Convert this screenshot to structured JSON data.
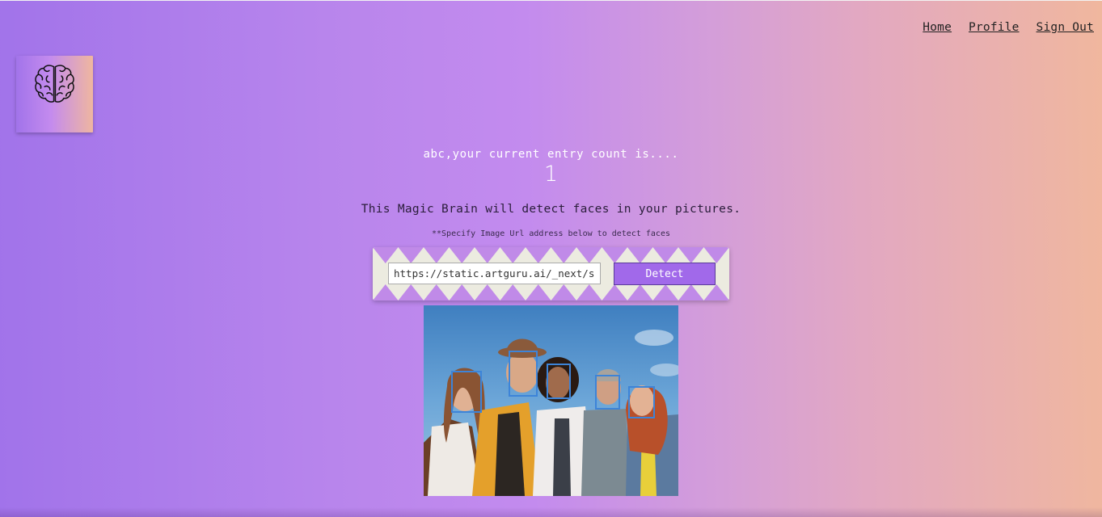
{
  "nav": {
    "home": "Home",
    "profile": "Profile",
    "signout": "Sign Out"
  },
  "logo": {
    "icon": "brain-icon"
  },
  "greeting": "abc,your current entry count is....",
  "entry_count": "1",
  "tagline": "This Magic Brain will detect faces in your pictures.",
  "hint": "**Specify Image Url address below to detect faces",
  "form": {
    "url_value": "https://static.artguru.ai/_next/static/media/face",
    "detect_label": "Detect"
  },
  "photo": {
    "description_icon": "group-photo",
    "face_count": 5
  },
  "colors": {
    "gradient_start": "#a173ea",
    "gradient_mid": "#c38bee",
    "gradient_end": "#f0b79e",
    "button": "#a169ea",
    "face_box": "#3d84d8"
  }
}
